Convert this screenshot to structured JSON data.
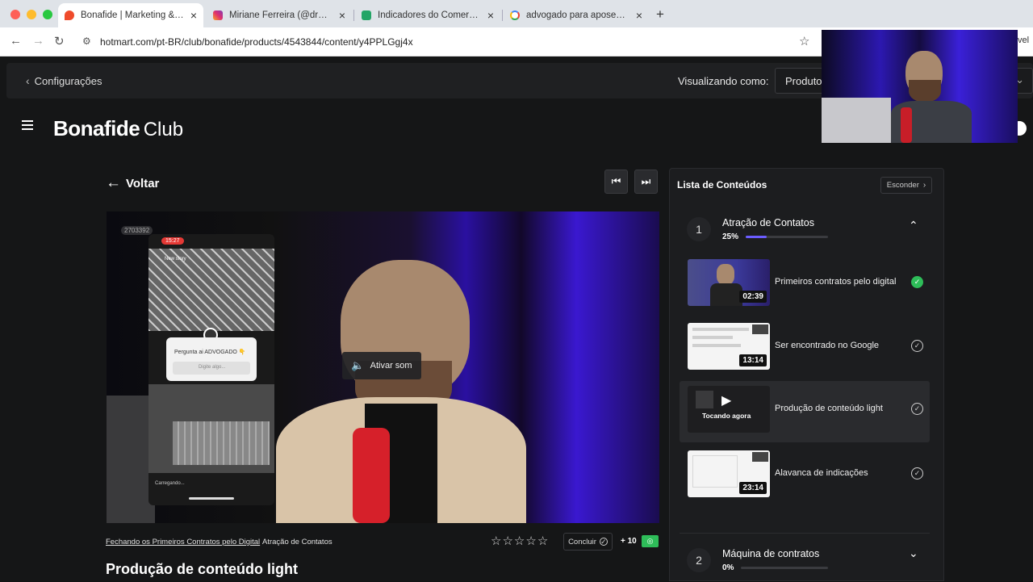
{
  "browser": {
    "tabs": [
      {
        "title": "Bonafide | Marketing & Venda",
        "active": true,
        "icon": "hotmart-flame-icon"
      },
      {
        "title": "Miriane Ferreira (@dra.miriane",
        "active": false,
        "icon": "instagram-icon"
      },
      {
        "title": "Indicadores do Comercial pa",
        "active": false,
        "icon": "sheets-icon"
      },
      {
        "title": "advogado para aposentadoria",
        "active": false,
        "icon": "google-icon"
      }
    ],
    "new_tab": "+",
    "url": "hotmart.com/pt-BR/club/bonafide/products/4543844/content/y4PPLGgj4x",
    "right_cut_text": "vel"
  },
  "cfg": {
    "back_label": "Configurações",
    "viewing_label": "Visualizando como:",
    "viewing_value": "Produto"
  },
  "header": {
    "logo_bold": "Bonafide",
    "logo_light": "Club"
  },
  "player": {
    "back_label": "Voltar",
    "unmute_label": "Ativar som",
    "phone_time": "15:27",
    "phone_story": "New story",
    "phone_question": "Pergunta ai ADVOGADO 👇",
    "phone_input": "Digite algo...",
    "phone_loading": "Carregando...",
    "watermark": "2703392"
  },
  "below": {
    "breadcrumb_course": "Fechando os Primeiros Contratos pelo Digital",
    "breadcrumb_module": "Atração de Contatos",
    "conclude_label": "Concluir",
    "points": "+ 10",
    "title": "Produção de conteúdo light",
    "rating": 0
  },
  "sidebar": {
    "title": "Lista de Conteúdos",
    "hide_label": "Esconder",
    "modules": [
      {
        "number": "1",
        "name": "Atração de Contatos",
        "progress_label": "25%",
        "progress": 0.25,
        "expanded": true
      },
      {
        "number": "2",
        "name": "Máquina de contratos",
        "progress_label": "0%",
        "progress": 0.0,
        "expanded": false
      }
    ],
    "items": [
      {
        "title": "Primeiros contratos pelo digital",
        "duration": "02:39",
        "completed": true,
        "playing": false
      },
      {
        "title": "Ser encontrado no Google",
        "duration": "13:14",
        "completed": false,
        "playing": false
      },
      {
        "title": "Produção de conteúdo light",
        "duration": "",
        "completed": false,
        "playing": true,
        "playing_label": "Tocando agora"
      },
      {
        "title": "Alavanca de indicações",
        "duration": "23:14",
        "completed": false,
        "playing": false
      }
    ]
  },
  "colors": {
    "accent_purple": "#6b5cff",
    "success_green": "#2ebd59",
    "background": "#151617"
  }
}
